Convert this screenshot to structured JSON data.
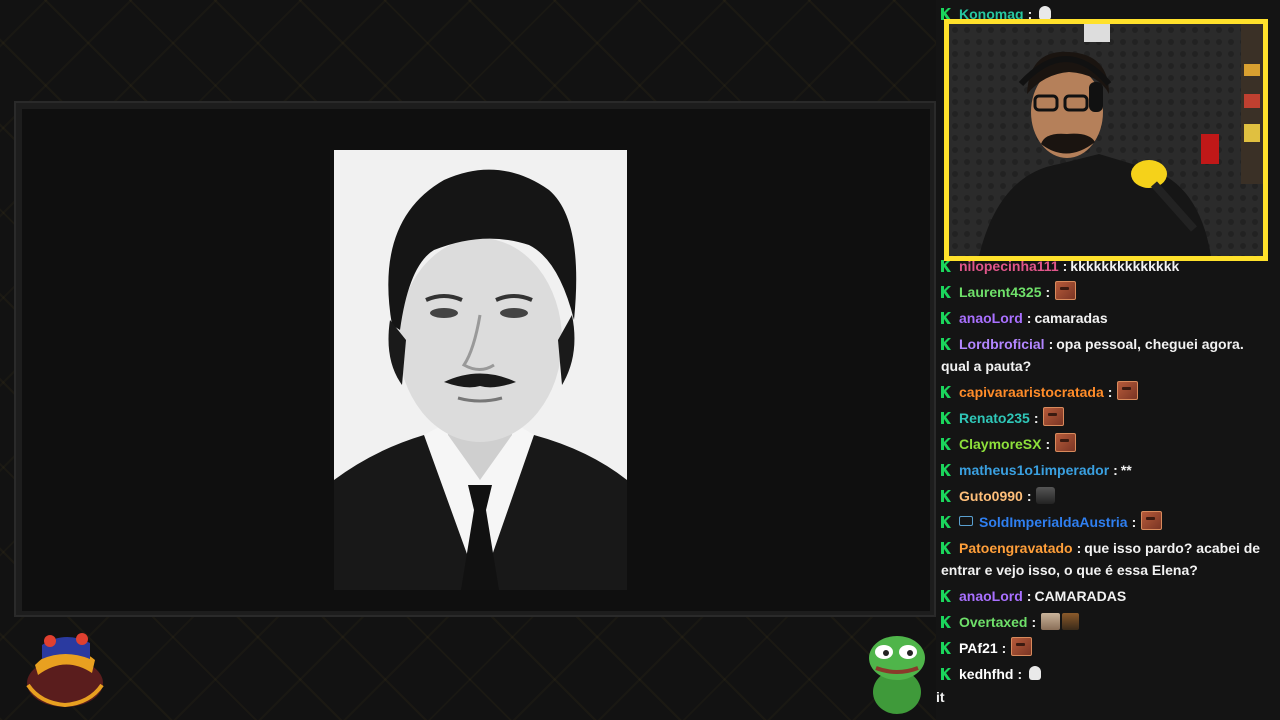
{
  "colors": {
    "badge_green": "#1bd65c",
    "webcam_border": "#ffe12b",
    "background": "#141414"
  },
  "chat": {
    "top_user": {
      "name": "Konomaq",
      "color": "#27c7a0",
      "emote": "ghost"
    },
    "messages": [
      {
        "user": "nilopecinha111",
        "color": "#e0568a",
        "text": "kkkkkkkkkkkkkk",
        "emotes": []
      },
      {
        "user": "Laurent4325",
        "color": "#6fe06a",
        "text": "",
        "emotes": [
          "face"
        ]
      },
      {
        "user": "anaoLord",
        "color": "#a970ff",
        "text": "camaradas",
        "emotes": []
      },
      {
        "user": "Lordbroficial",
        "color": "#b386ff",
        "text": "opa pessoal, cheguei agora.",
        "text2": "qual a pauta?",
        "emotes": []
      },
      {
        "user": "capivaraaristocratada",
        "color": "#ff8c29",
        "text": "",
        "emotes": [
          "face"
        ]
      },
      {
        "user": "Renato235",
        "color": "#2fc7b8",
        "text": "",
        "emotes": [
          "face"
        ]
      },
      {
        "user": "ClaymoreSX",
        "color": "#8ee03b",
        "text": "",
        "emotes": [
          "face"
        ]
      },
      {
        "user": "matheus1o1imperador",
        "color": "#3aa0e0",
        "text": "**",
        "emotes": []
      },
      {
        "user": "Guto0990",
        "color": "#ffbf7a",
        "text": "",
        "emotes": [
          "person"
        ]
      },
      {
        "user": "SoldImperialdaAustria",
        "color": "#2f7ff0",
        "text": "",
        "emotes": [
          "face"
        ],
        "prefix_icon": "badge-icon"
      },
      {
        "user": "Patoengravatado",
        "color": "#ff9f3a",
        "text": "que isso pardo? acabei de",
        "text2": "entrar e vejo isso, o que é essa Elena?",
        "emotes": []
      },
      {
        "user": "anaoLord",
        "color": "#a970ff",
        "text": "CAMARADAS",
        "emotes": []
      },
      {
        "user": "Overtaxed",
        "color": "#6fe06a",
        "text": "",
        "emotes": [
          "cat",
          "cup"
        ]
      },
      {
        "user": "PAf21",
        "color": "#ffffff",
        "text": "",
        "emotes": [
          "face"
        ]
      },
      {
        "user": "kedhfhd",
        "color": "#ffffff",
        "text": "",
        "emotes": [
          "ghost"
        ]
      }
    ],
    "cutoff_text": "it"
  }
}
